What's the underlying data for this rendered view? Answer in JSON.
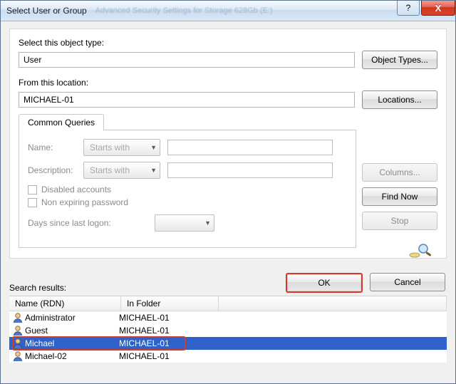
{
  "titlebar": {
    "title": "Select User or Group",
    "behind_text": "Advanced Security Settings for Storage 628Gb (E:)",
    "help_tooltip": "?",
    "close_tooltip": "X"
  },
  "object_type": {
    "label": "Select this object type:",
    "value": "User",
    "button": "Object Types..."
  },
  "location": {
    "label": "From this location:",
    "value": "MICHAEL-01",
    "button": "Locations..."
  },
  "common_queries": {
    "tab_label": "Common Queries",
    "name_label": "Name:",
    "name_mode": "Starts with",
    "description_label": "Description:",
    "description_mode": "Starts with",
    "disabled_accounts": "Disabled accounts",
    "non_expiring": "Non expiring password",
    "days_since_label": "Days since last logon:"
  },
  "side_buttons": {
    "columns": "Columns...",
    "find_now": "Find Now",
    "stop": "Stop"
  },
  "actions": {
    "ok": "OK",
    "cancel": "Cancel"
  },
  "results": {
    "label": "Search results:",
    "col_name": "Name (RDN)",
    "col_folder": "In Folder",
    "rows": [
      {
        "name": "Administrator",
        "folder": "MICHAEL-01"
      },
      {
        "name": "Guest",
        "folder": "MICHAEL-01"
      },
      {
        "name": "Michael",
        "folder": "MICHAEL-01"
      },
      {
        "name": "Michael-02",
        "folder": "MICHAEL-01"
      }
    ],
    "selected_index": 2,
    "highlighted_index": 2
  }
}
